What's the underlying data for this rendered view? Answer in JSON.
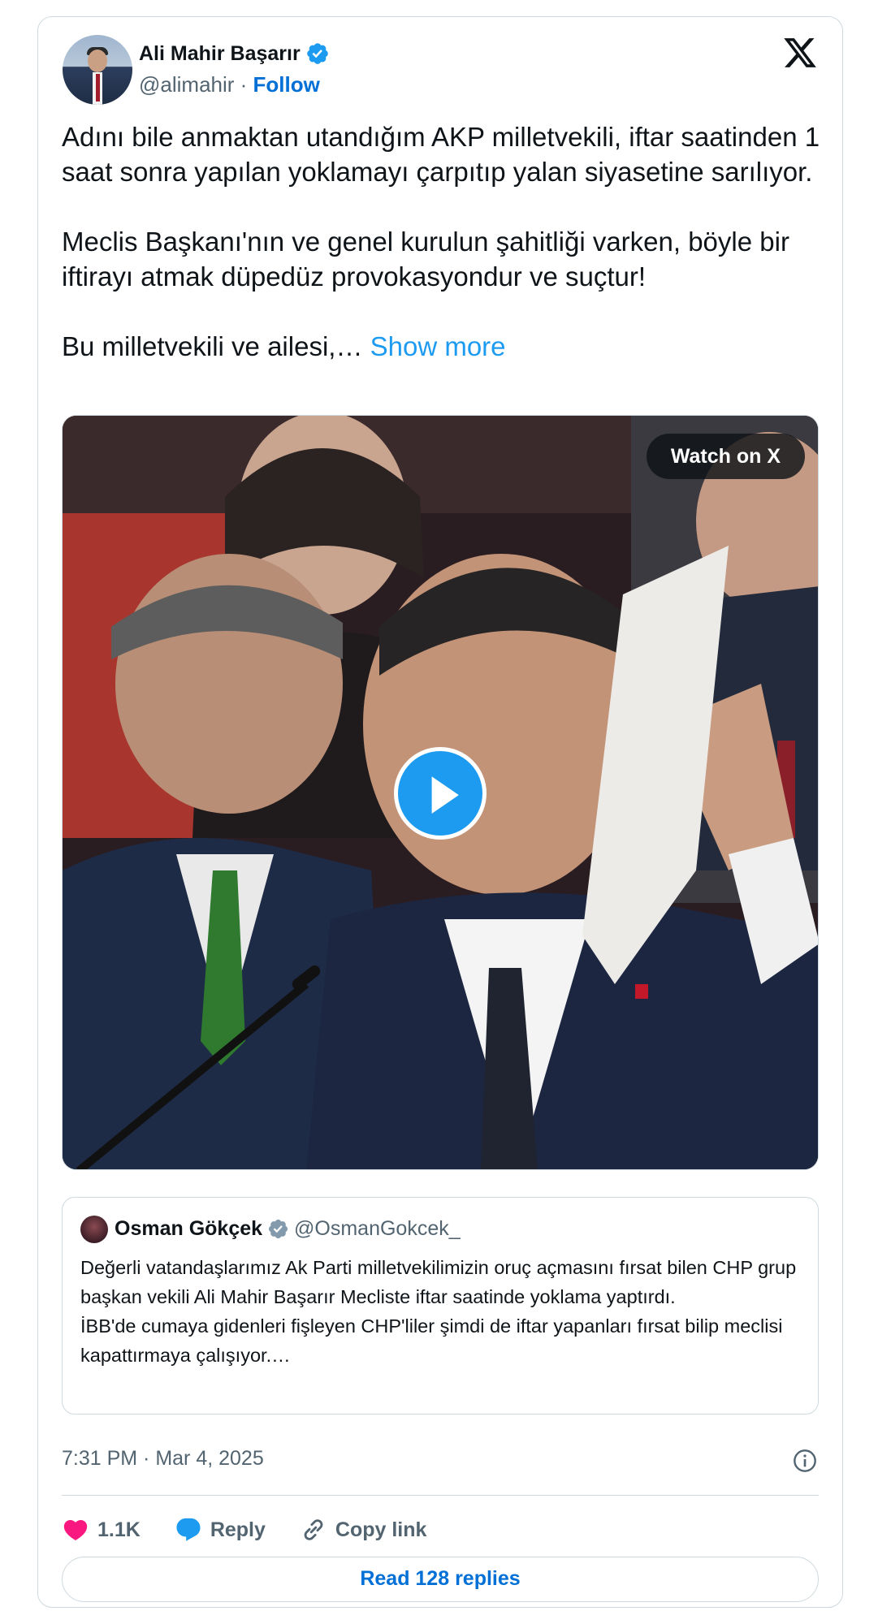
{
  "author": {
    "name": "Ali Mahir Başarır",
    "handle": "@alimahir",
    "separator": " · ",
    "follow_label": "Follow"
  },
  "tweet": {
    "paragraph_1": "Adını bile anmaktan utandığım AKP milletvekili, iftar saatinden 1 saat sonra yapılan yoklamayı çarpıtıp yalan siyasetine sarılıyor.",
    "paragraph_2": "Meclis Başkanı'nın ve genel kurulun şahitliği varken, böyle bir iftirayı atmak düpedüz provokasyondur ve suçtur!",
    "paragraph_3": "Bu milletvekili ve ailesi,… ",
    "show_more_label": "Show more"
  },
  "media": {
    "watch_label": "Watch on X"
  },
  "quote": {
    "name": "Osman Gökçek",
    "handle": "@OsmanGokcek_",
    "line_1": "Değerli vatandaşlarımız Ak Parti milletvekilimizin oruç açmasını fırsat bilen CHP grup başkan vekili Ali Mahir Başarır Mecliste iftar saatinde yoklama yaptırdı.",
    "line_2": "İBB'de cumaya gidenleri fişleyen CHP'liler şimdi de iftar yapanları fırsat bilip meclisi kapattırmaya çalışıyor.…"
  },
  "footer": {
    "timestamp": "7:31 PM · Mar 4, 2025",
    "like_count": "1.1K",
    "reply_label": "Reply",
    "copy_link_label": "Copy link",
    "read_replies_label": "Read 128 replies"
  },
  "colors": {
    "accent": "#1d9bf0",
    "link": "#006fd6",
    "like": "#f91880",
    "muted": "#536471",
    "border": "#cfd9de"
  },
  "icons": [
    "verified-badge-icon",
    "x-logo-icon",
    "play-icon",
    "info-icon",
    "heart-icon",
    "reply-bubble-icon",
    "link-icon"
  ]
}
